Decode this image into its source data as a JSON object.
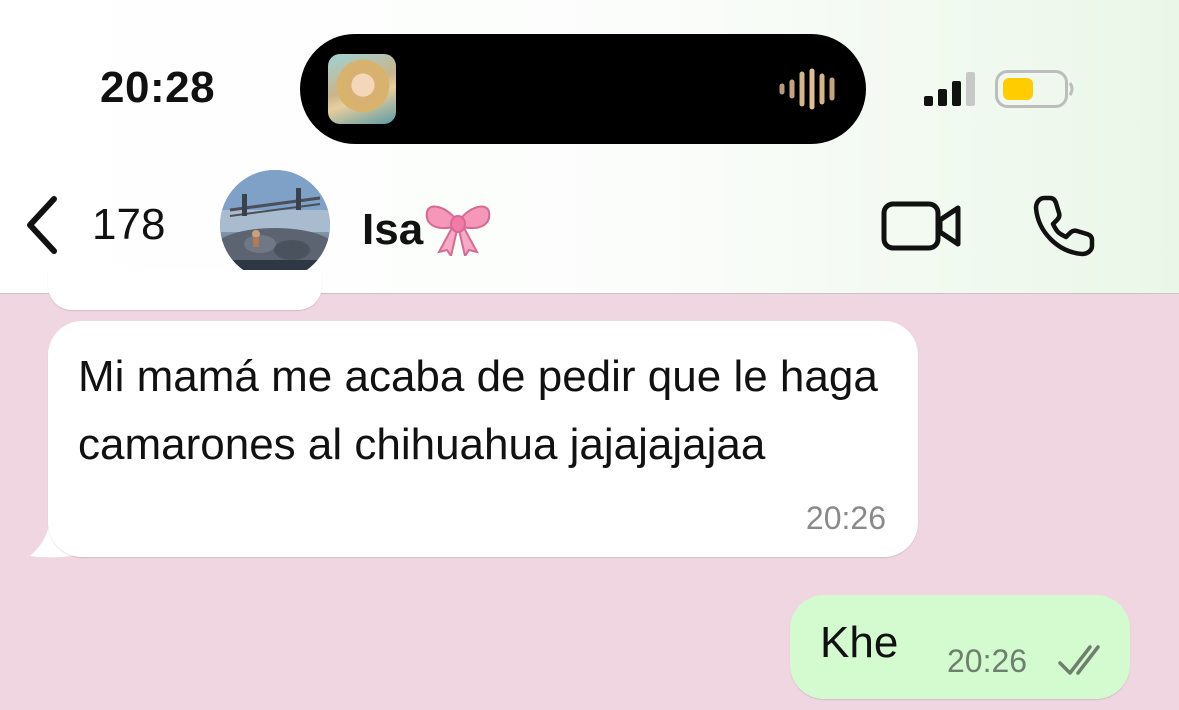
{
  "status_bar": {
    "time": "20:28",
    "now_playing_icon": "album-art",
    "waveform_icon": "waveform-icon",
    "signal_icon": "cellular-signal-icon",
    "battery_icon": "battery-icon",
    "battery_color": "#ffcc00"
  },
  "header": {
    "back_icon": "chevron-left-icon",
    "back_count": "178",
    "contact_name": "Isa",
    "contact_emoji": "ribbon-bow",
    "video_call_icon": "video-camera-icon",
    "voice_call_icon": "phone-icon"
  },
  "messages": [
    {
      "direction": "incoming",
      "text": "Mi mamá me acaba de pedir que le haga camarones al chihuahua jajajajajaa",
      "time": "20:26"
    },
    {
      "direction": "outgoing",
      "text": "Khe",
      "time": "20:26",
      "status_icon": "double-check-icon"
    }
  ],
  "colors": {
    "chat_background": "#f0d6e1",
    "incoming_bubble": "#ffffff",
    "outgoing_bubble": "#d3fbcf"
  }
}
